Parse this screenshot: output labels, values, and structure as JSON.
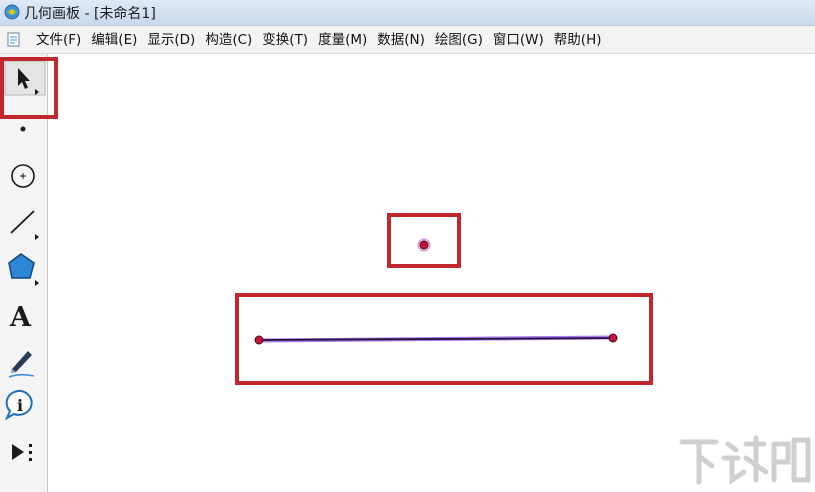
{
  "window": {
    "title": "几何画板 - [未命名1]"
  },
  "menu": {
    "items": [
      {
        "label": "文件(F)"
      },
      {
        "label": "编辑(E)"
      },
      {
        "label": "显示(D)"
      },
      {
        "label": "构造(C)"
      },
      {
        "label": "变换(T)"
      },
      {
        "label": "度量(M)"
      },
      {
        "label": "数据(N)"
      },
      {
        "label": "绘图(G)"
      },
      {
        "label": "窗口(W)"
      },
      {
        "label": "帮助(H)"
      }
    ]
  },
  "toolbox": {
    "tools": [
      {
        "name": "selection-arrow-tool",
        "icon": "arrow-icon",
        "highlighted": true
      },
      {
        "name": "point-tool",
        "icon": "point-icon"
      },
      {
        "name": "compass-tool",
        "icon": "circle-icon"
      },
      {
        "name": "straightedge-tool",
        "icon": "segment-icon"
      },
      {
        "name": "polygon-tool",
        "icon": "polygon-icon"
      },
      {
        "name": "text-tool",
        "icon": "text-a-icon",
        "glyph": "A"
      },
      {
        "name": "marker-tool",
        "icon": "marker-pen-icon"
      },
      {
        "name": "information-tool",
        "icon": "info-icon",
        "glyph": "i"
      },
      {
        "name": "custom-tool",
        "icon": "custom-play-icon"
      }
    ]
  },
  "canvas": {
    "objects": [
      {
        "type": "point",
        "name": "point",
        "color": "#c0143c",
        "highlighted": true
      },
      {
        "type": "segment",
        "name": "line-segment",
        "color": "#2b1a4a",
        "select_color": "#8a5cf5",
        "highlighted": true
      }
    ]
  },
  "colors": {
    "highlight_box": "#c1272d",
    "point": "#c0143c"
  },
  "watermark": {
    "label": "下载吧"
  }
}
